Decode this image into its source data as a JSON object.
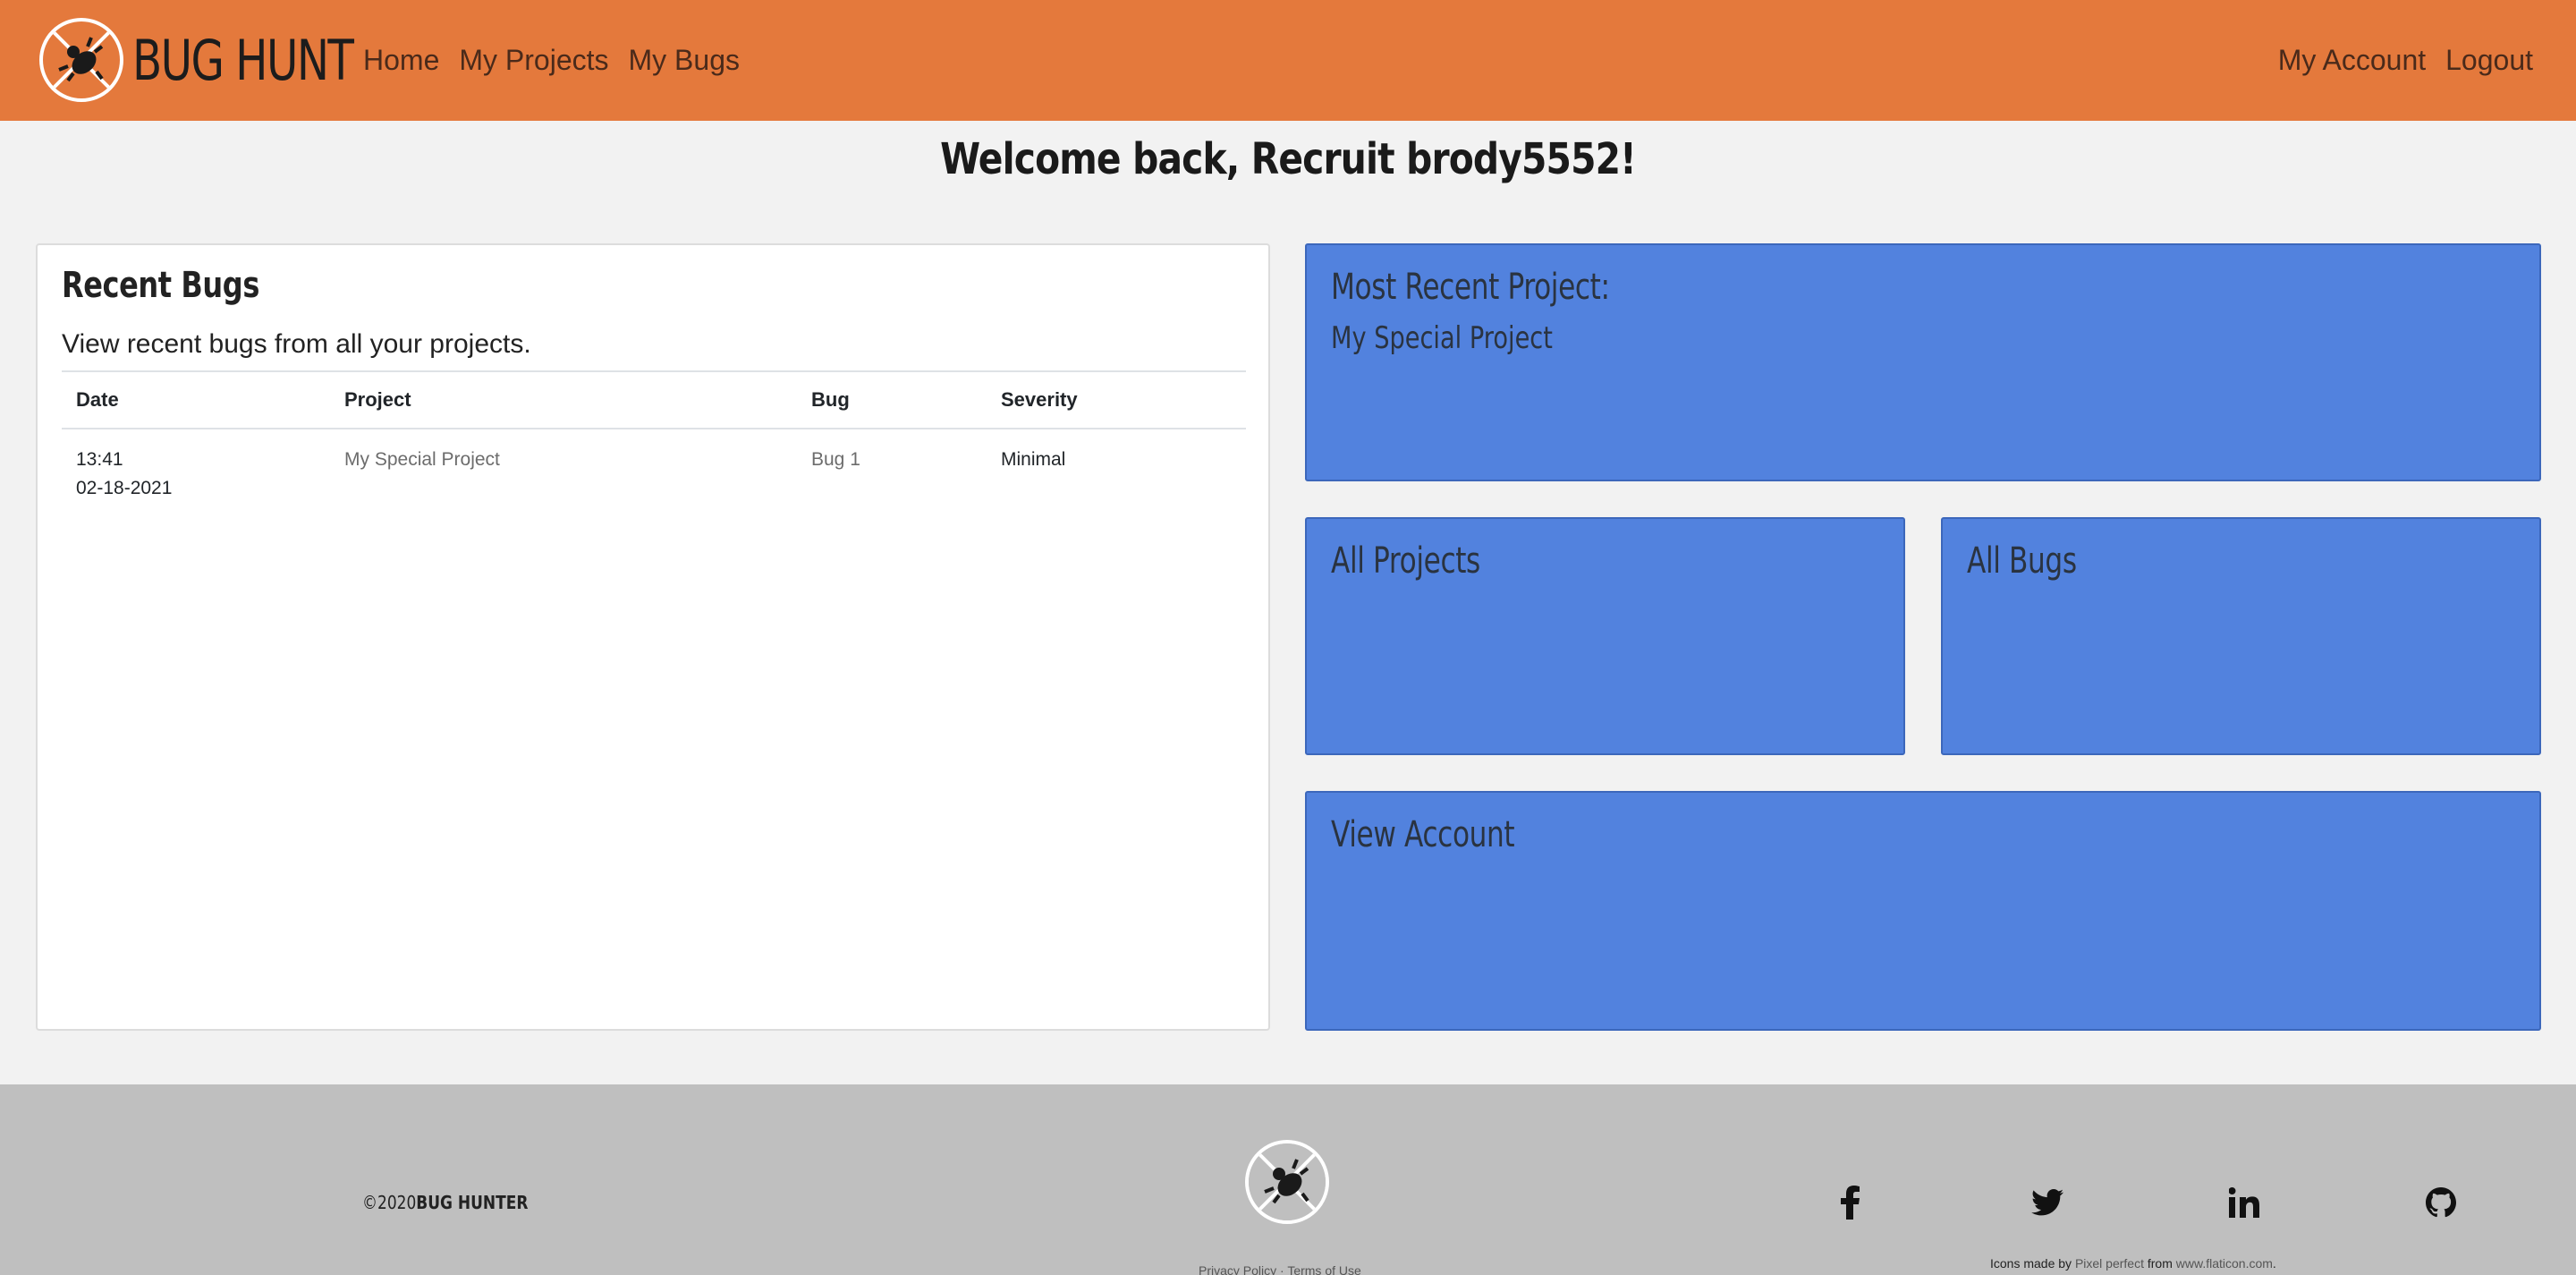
{
  "navbar": {
    "brand": "BUG HUNT",
    "links_left": [
      "Home",
      "My Projects",
      "My Bugs"
    ],
    "links_right": [
      "My Account",
      "Logout"
    ],
    "color": "#e4793c"
  },
  "welcome": "Welcome back, Recruit brody5552!",
  "recent_bugs": {
    "title": "Recent Bugs",
    "subtitle": "View recent bugs from all your projects.",
    "columns": [
      "Date",
      "Project",
      "Bug",
      "Severity"
    ],
    "rows": [
      {
        "time": "13:41",
        "date": "02-18-2021",
        "project": "My Special Project",
        "bug": "Bug 1",
        "severity": "Minimal"
      }
    ]
  },
  "tiles": {
    "recent_project_title": "Most Recent Project:",
    "recent_project_name": "My Special Project",
    "all_projects": "All Projects",
    "all_bugs": "All Bugs",
    "view_account": "View Account",
    "color": "#5282de"
  },
  "footer": {
    "copyright_prefix": "©2020",
    "copyright_name": "BUG HUNTER",
    "links": "Privacy Policy · Terms of Use",
    "credits_prefix": "Icons made by ",
    "credits_author": "Pixel perfect",
    "credits_mid": " from ",
    "credits_site": "www.flaticon.com",
    "credits_suffix": ".",
    "social_icons": [
      "facebook-icon",
      "twitter-icon",
      "linkedin-icon",
      "github-icon"
    ]
  }
}
